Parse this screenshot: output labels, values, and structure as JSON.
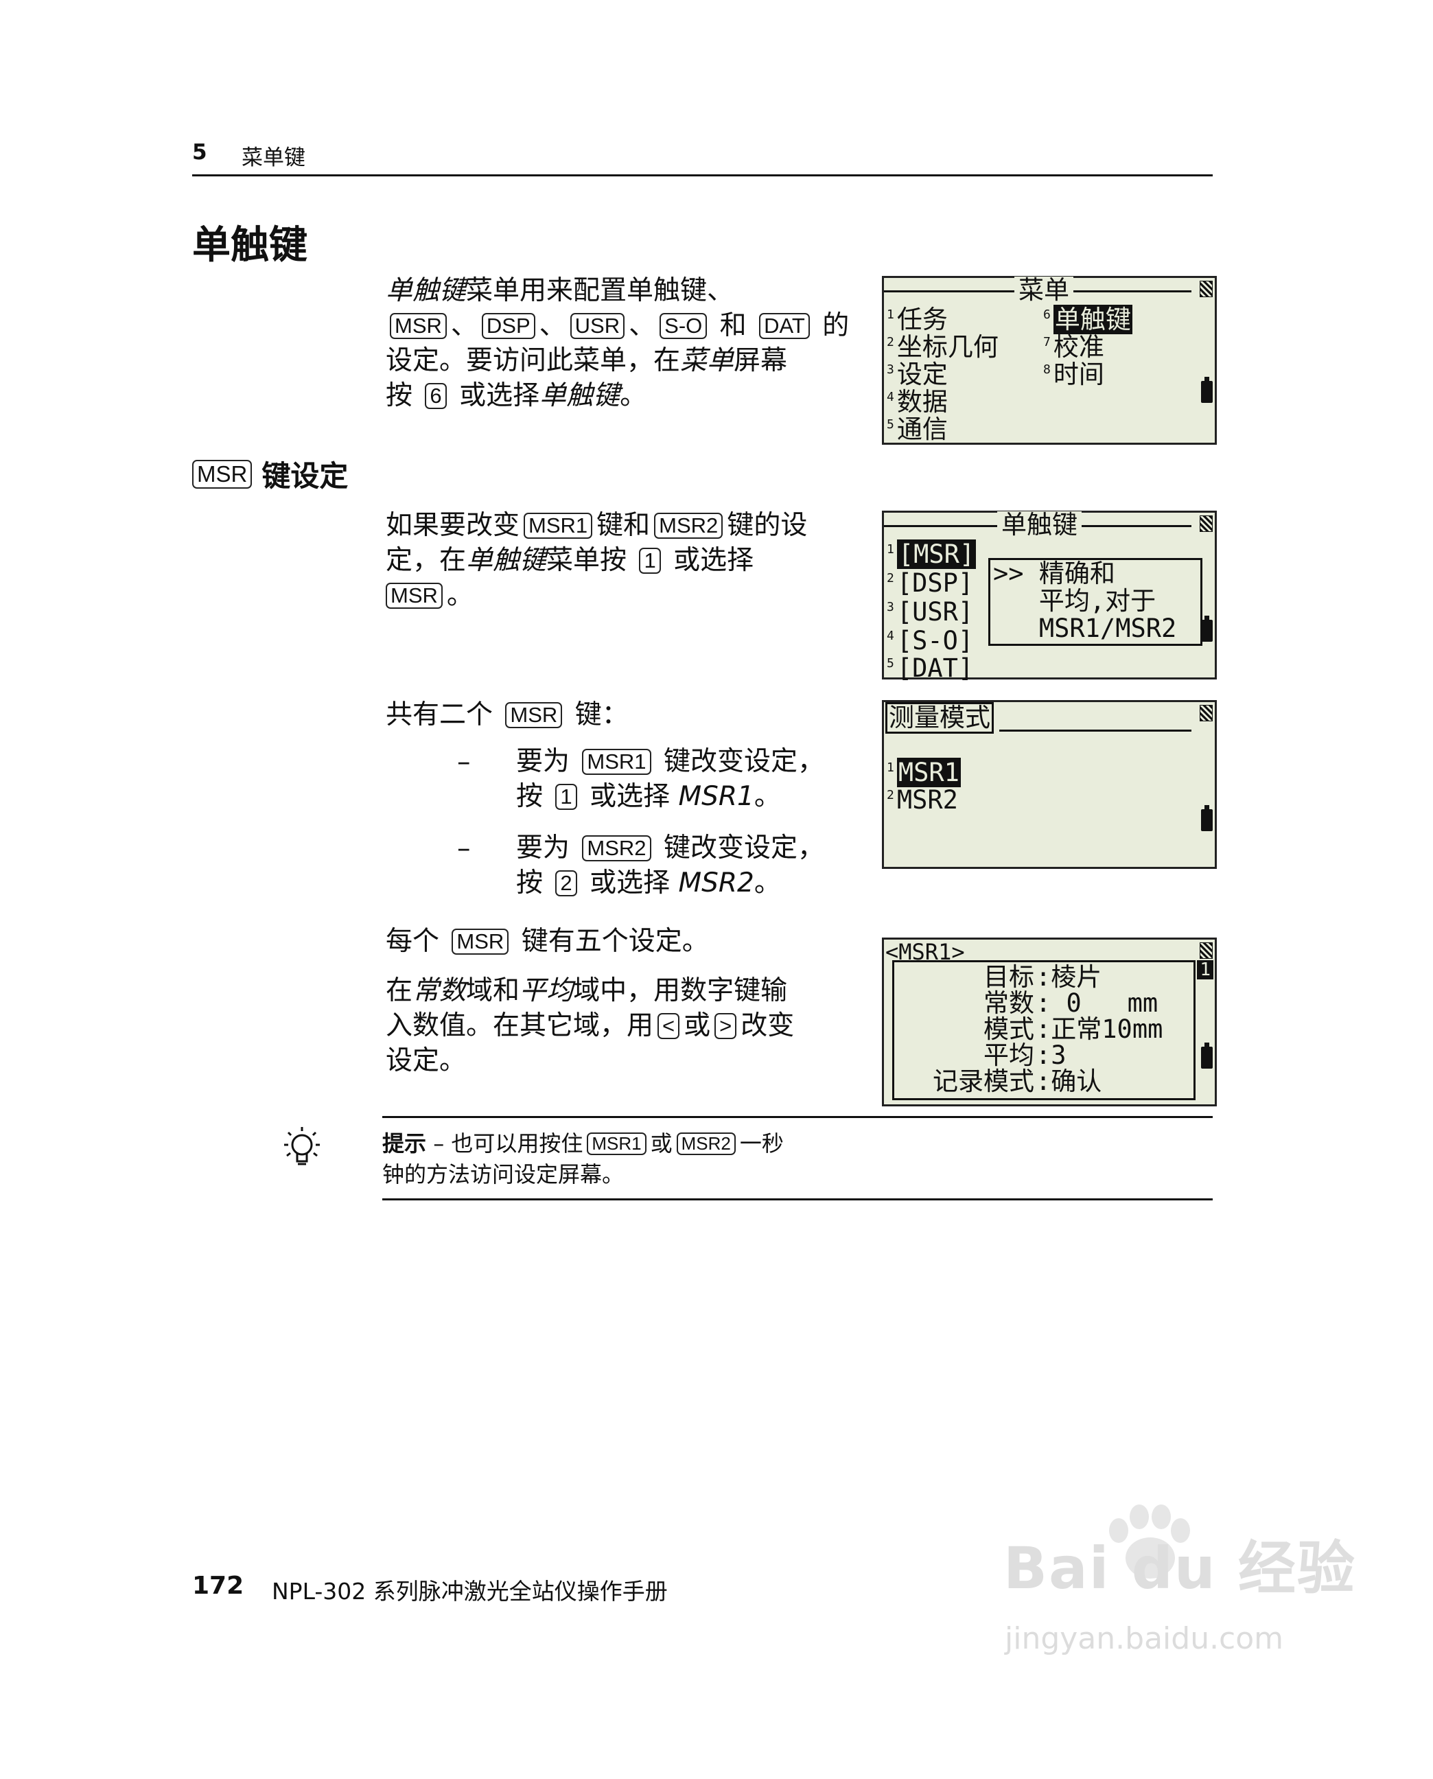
{
  "header": {
    "chapter_num": "5",
    "chapter_title": "菜单键"
  },
  "section_title": "单触键",
  "intro": {
    "l1_italic": "单触键",
    "l1_rest": "菜单用来配置单触键、",
    "keys": [
      "MSR",
      "DSP",
      "USR",
      "S-O",
      "DAT"
    ],
    "sep": "、",
    "and": "和",
    "de": "的",
    "l3_a": "设定。要访问此菜单，在",
    "l3_italic": "菜单",
    "l3_b": "屏幕",
    "l4_a": "按",
    "l4_key": "6",
    "l4_b": "或选择",
    "l4_italic": "单触键",
    "l4_c": "。"
  },
  "msr_section": {
    "key": "MSR",
    "title": "键设定"
  },
  "para2": {
    "a": "如果要改变",
    "k1": "MSR1",
    "b": "键和",
    "k2": "MSR2",
    "c": "键的设",
    "d": "定，在",
    "italic": "单触键",
    "e": "菜单按",
    "k3": "1",
    "f": "或选择",
    "k4": "MSR",
    "g": "。"
  },
  "para3": {
    "a": "共有二个",
    "key": "MSR",
    "b": "键："
  },
  "bullets": [
    {
      "dash": "–",
      "a": "要为",
      "key": "MSR1",
      "b": "键改变设定，",
      "c": "按",
      "k2": "1",
      "d": "或选择",
      "italic": "MSR1",
      "e": "。"
    },
    {
      "dash": "–",
      "a": "要为",
      "key": "MSR2",
      "b": "键改变设定，",
      "c": "按",
      "k2": "2",
      "d": "或选择",
      "italic": "MSR2",
      "e": "。"
    }
  ],
  "para4": {
    "a": "每个",
    "key": "MSR",
    "b": "键有五个设定。"
  },
  "para5": {
    "a": "在",
    "i1": "常数",
    "b": "域和",
    "i2": "平均",
    "c": "域中，用数字键输",
    "d": "入数值。在其它域，用",
    "k1": "<",
    "e": "或",
    "k2": ">",
    "f": "改变",
    "g": "设定。"
  },
  "tip": {
    "label": "提示",
    "a": " – 也可以用按住",
    "k1": "MSR1",
    "b": "或",
    "k2": "MSR2",
    "c": "一秒",
    "d": "钟的方法访问设定屏幕。"
  },
  "screens": {
    "menu": {
      "title": "菜单",
      "left": [
        {
          "n": "1",
          "t": "任务"
        },
        {
          "n": "2",
          "t": "坐标几何"
        },
        {
          "n": "3",
          "t": "设定"
        },
        {
          "n": "4",
          "t": "数据"
        },
        {
          "n": "5",
          "t": "通信"
        }
      ],
      "right": [
        {
          "n": "6",
          "t": "单触键"
        },
        {
          "n": "7",
          "t": "校准"
        },
        {
          "n": "8",
          "t": "时间"
        }
      ]
    },
    "onetouch": {
      "title": "单触键",
      "items": [
        {
          "n": "1",
          "t": "[MSR]"
        },
        {
          "n": "2",
          "t": "[DSP]"
        },
        {
          "n": "3",
          "t": "[USR]"
        },
        {
          "n": "4",
          "t": "[S-O]"
        },
        {
          "n": "5",
          "t": "[DAT]"
        }
      ],
      "popup": [
        ">> 精确和",
        "   平均,对于",
        "   MSR1/MSR2"
      ]
    },
    "measmode": {
      "title": "测量模式",
      "items": [
        {
          "n": "1",
          "t": "MSR1"
        },
        {
          "n": "2",
          "t": "MSR2"
        }
      ]
    },
    "msr1": {
      "title": "<MSR1>",
      "page": "1",
      "rows": [
        {
          "label": "目标",
          "value": "棱片"
        },
        {
          "label": "常数",
          "value": " 0   mm"
        },
        {
          "label": "模式",
          "value": "正常10mm"
        },
        {
          "label": "平均",
          "value": "3"
        },
        {
          "label": "记录模式",
          "value": "确认"
        }
      ]
    }
  },
  "footer": {
    "page_num": "172",
    "title": "NPL-302 系列脉冲激光全站仪操作手册"
  },
  "watermark": {
    "logo": "Bai du 经验",
    "url": "jingyan.baidu.com"
  }
}
